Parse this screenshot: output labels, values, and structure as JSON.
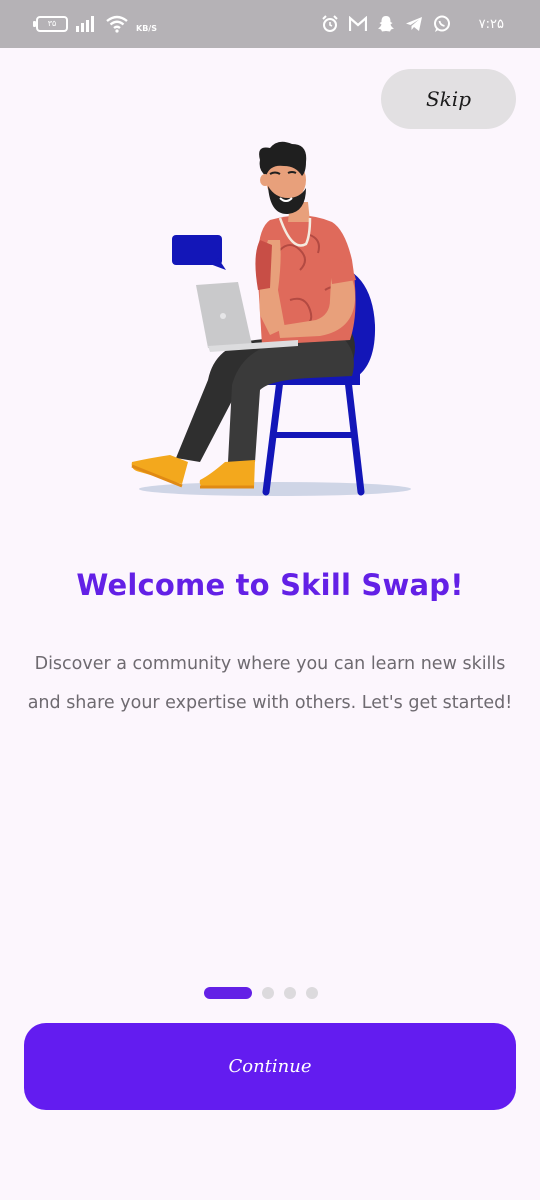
{
  "status_bar": {
    "battery_level": "۳۵",
    "speed_unit": "KB/S",
    "time": "۷:۲۵",
    "icons": [
      "battery-icon",
      "signal-icon",
      "wifi-icon",
      "alarm-icon",
      "gmail-icon",
      "snapchat-icon",
      "telegram-icon",
      "whatsapp-icon"
    ]
  },
  "onboarding": {
    "skip_label": "Skip",
    "title": "Welcome to Skill Swap!",
    "description": "Discover a community where you can learn new skills and share your expertise with others. Let's get started!",
    "page_count": 4,
    "current_page": 1,
    "continue_label": "Continue"
  },
  "colors": {
    "accent": "#631cf0",
    "title": "#6320e6",
    "background": "#fcf6fd",
    "body_text": "#6e6a70",
    "skip_bg": "#e2e0e2"
  }
}
